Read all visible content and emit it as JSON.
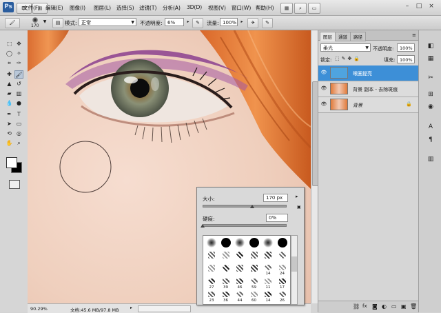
{
  "app": {
    "logo": "Ps"
  },
  "menu": {
    "items": [
      "文件(F)",
      "编辑(E)",
      "图像(I)",
      "图层(L)",
      "选择(S)",
      "滤镜(T)",
      "分析(A)",
      "3D(D)",
      "视图(V)",
      "窗口(W)",
      "帮助(H)"
    ]
  },
  "window_controls": {
    "minimize": "–",
    "restore": "□",
    "close": "×"
  },
  "options_bar": {
    "brush_size": "170",
    "mode_label": "模式:",
    "mode_value": "正常",
    "opacity_label": "不透明度:",
    "opacity_value": "6%",
    "flow_label": "流量:",
    "flow_value": "100%"
  },
  "brush_picker": {
    "size_label": "大小:",
    "size_value": "170 px",
    "size_fraction": 0.6,
    "hardness_label": "硬度:",
    "hardness_value": "0%",
    "hardness_fraction": 0.0,
    "brush_numbers": [
      [
        "",
        "",
        "",
        "",
        "",
        ""
      ],
      [
        "",
        "",
        "",
        "",
        "",
        ""
      ],
      [
        "",
        "",
        "",
        "",
        "14",
        "24"
      ],
      [
        "27",
        "39",
        "46",
        "59",
        "11",
        "17"
      ],
      [
        "23",
        "36",
        "44",
        "60",
        "14",
        "26"
      ]
    ]
  },
  "status": {
    "zoom": "90.29%",
    "doc_info": "文档:45.6 MB/97.8 MB"
  },
  "layers_panel": {
    "tabs": [
      "图层",
      "通道",
      "路径"
    ],
    "blend_mode": "柔光",
    "opacity_label": "不透明度:",
    "opacity_value": "100%",
    "lock_label": "锁定:",
    "fill_label": "填充:",
    "fill_value": "100%",
    "layers": [
      {
        "name": "眼圈提亮",
        "selected": true
      },
      {
        "name": "背景 副本 - 去除斑痕",
        "selected": false
      },
      {
        "name": "背景",
        "selected": false
      }
    ]
  },
  "colors": {
    "accent": "#3d8fd7",
    "skin": "#f1d3c3",
    "hair": "#e0732f",
    "iris": "#7d8468"
  }
}
